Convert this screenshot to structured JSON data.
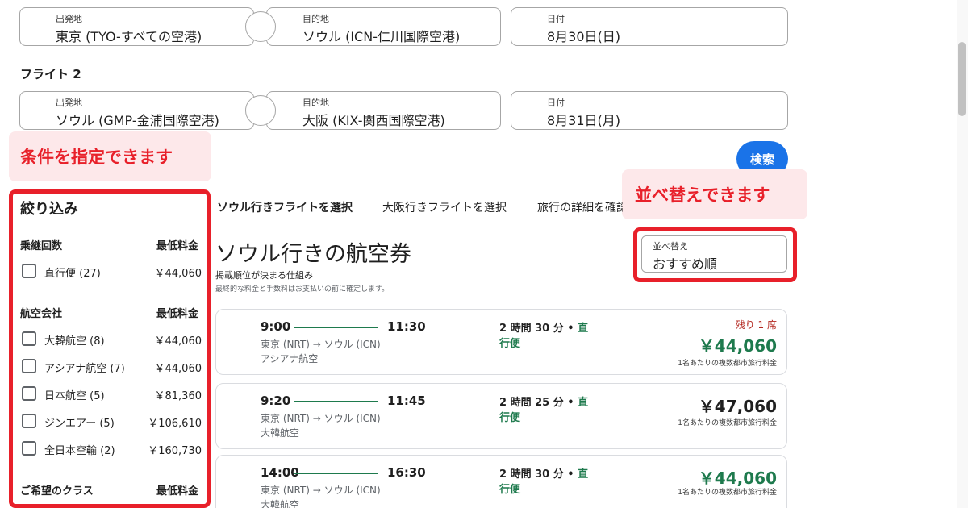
{
  "flight1": {
    "origin": {
      "label": "出発地",
      "value": "東京 (TYO-すべての空港)"
    },
    "destination": {
      "label": "目的地",
      "value": "ソウル (ICN-仁川国際空港)"
    },
    "date": {
      "label": "日付",
      "value": "8月30日(日)"
    }
  },
  "flight2": {
    "title": "フライト 2",
    "origin": {
      "label": "出発地",
      "value": "ソウル (GMP-金浦国際空港)"
    },
    "destination": {
      "label": "目的地",
      "value": "大阪 (KIX-関西国際空港)"
    },
    "date": {
      "label": "日付",
      "value": "8月31日(月)"
    }
  },
  "search_button": "検索",
  "annotations": {
    "conditions": "条件を指定できます",
    "sort": "並べ替えできます",
    "highlight_color": "#e8202a",
    "callout_bg": "#fde8ea"
  },
  "filters": {
    "title": "絞り込み",
    "stops": {
      "heading": "乗継回数",
      "price_heading": "最低料金",
      "items": [
        {
          "name": "直行便 (27)",
          "price": "￥44,060"
        }
      ]
    },
    "airlines": {
      "heading": "航空会社",
      "price_heading": "最低料金",
      "items": [
        {
          "name": "大韓航空 (8)",
          "price": "￥44,060"
        },
        {
          "name": "アシアナ航空 (7)",
          "price": "￥44,060"
        },
        {
          "name": "日本航空 (5)",
          "price": "￥81,360"
        },
        {
          "name": "ジンエアー (5)",
          "price": "￥106,610"
        },
        {
          "name": "全日本空輸 (2)",
          "price": "￥160,730"
        }
      ]
    },
    "cabin": {
      "heading": "ご希望のクラス",
      "price_heading": "最低料金"
    }
  },
  "tabs": [
    {
      "label": "ソウル行きフライトを選択",
      "active": true
    },
    {
      "label": "大阪行きフライトを選択",
      "active": false
    },
    {
      "label": "旅行の詳細を確認",
      "active": false
    }
  ],
  "results": {
    "heading": "ソウル行きの航空券",
    "ranking_link": "掲載順位が決まる仕組み",
    "fee_note": "最終的な料金と手数料はお支払いの前に確定します。",
    "sort": {
      "label": "並べ替え",
      "value": "おすすめ順"
    },
    "flights": [
      {
        "depart": "9:00",
        "arrive": "11:30",
        "route": "東京 (NRT) → ソウル (ICN)",
        "airline": "アシアナ航空",
        "duration": "2 時間 30 分 • ",
        "nonstop_a": "直",
        "nonstop_b": "行便",
        "seats_left": "残り 1 席",
        "price": "￥44,060",
        "price_color": "green",
        "price_note": "1名あたりの複数都市旅行料金"
      },
      {
        "depart": "9:20",
        "arrive": "11:45",
        "route": "東京 (NRT) → ソウル (ICN)",
        "airline": "大韓航空",
        "duration": "2 時間 25 分 • ",
        "nonstop_a": "直",
        "nonstop_b": "行便",
        "seats_left": "",
        "price": "￥47,060",
        "price_color": "black",
        "price_note": "1名あたりの複数都市旅行料金"
      },
      {
        "depart": "14:00",
        "arrive": "16:30",
        "route": "東京 (NRT) → ソウル (ICN)",
        "airline": "大韓航空",
        "duration": "2 時間 30 分 • ",
        "nonstop_a": "直",
        "nonstop_b": "行便",
        "seats_left": "",
        "price": "￥44,060",
        "price_color": "green",
        "price_note": "1名あたりの複数都市旅行料金"
      }
    ]
  }
}
